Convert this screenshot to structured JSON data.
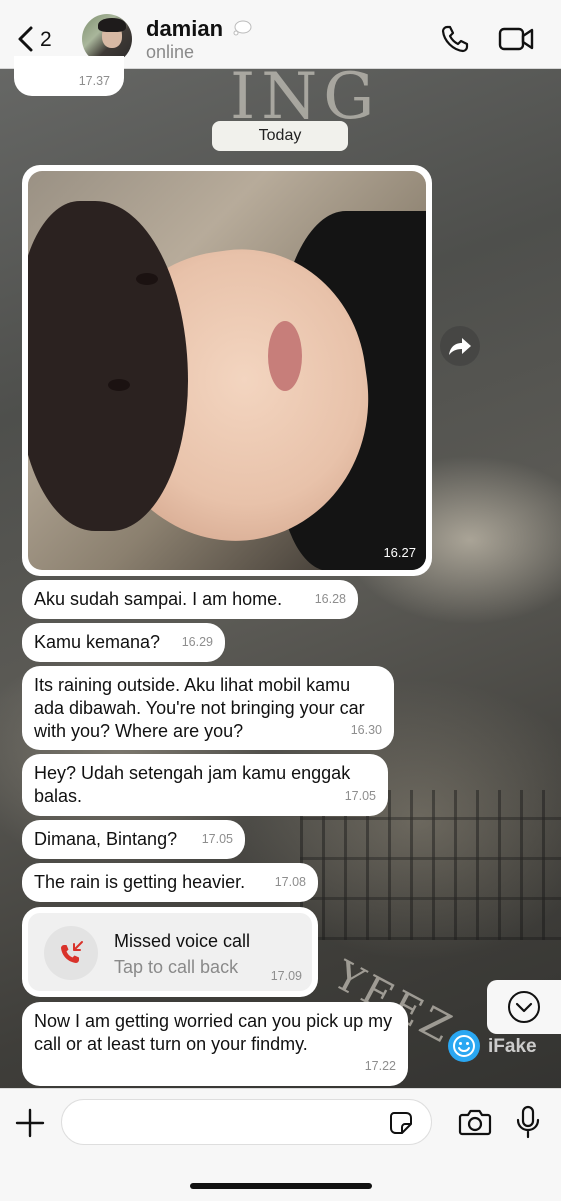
{
  "header": {
    "back_count": "2",
    "contact_name": "damian",
    "status": "online"
  },
  "previous_message": {
    "time": "17.37"
  },
  "date_separator": "Today",
  "photo_message": {
    "time": "16.27"
  },
  "messages": [
    {
      "text": "Aku sudah sampai. I am home.",
      "time": "16.28"
    },
    {
      "text": "Kamu kemana?",
      "time": "16.29"
    },
    {
      "text": "Its raining outside. Aku lihat mobil kamu ada dibawah. You're not bringing your car with you? Where are you?",
      "time": "16.30"
    },
    {
      "text": "Hey? Udah setengah jam kamu enggak balas.",
      "time": "17.05"
    },
    {
      "text": "Dimana, Bintang?",
      "time": "17.05"
    },
    {
      "text": "The rain is getting heavier.",
      "time": "17.08"
    },
    {
      "text": "Now I am getting worried can you pick up my call or at least turn on your findmy.",
      "time": "17.22"
    }
  ],
  "missed_call": {
    "title": "Missed voice call",
    "subtitle": "Tap to call back",
    "time": "17.09"
  },
  "watermark": "iFake",
  "wallpaper_text": {
    "top": "ING",
    "bottom": "YEEZ"
  },
  "colors": {
    "missed_red": "#d9322a",
    "badge_blue": "#2aa7f2"
  },
  "input": {
    "placeholder": ""
  }
}
